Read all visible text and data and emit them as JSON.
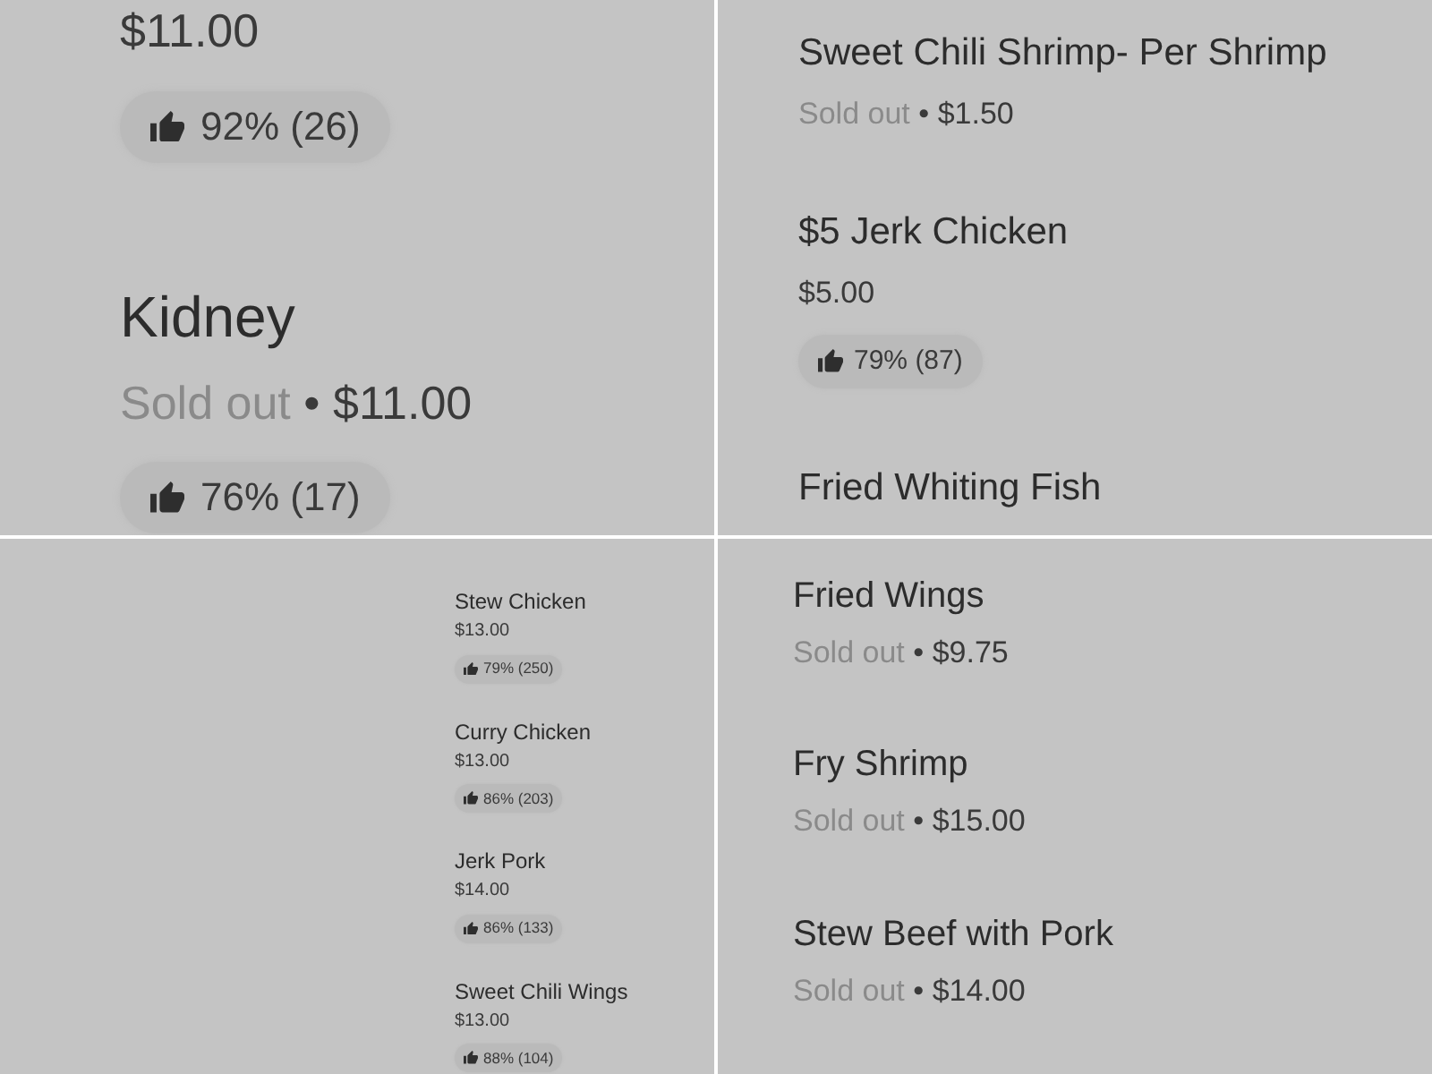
{
  "panels": [
    {
      "items": [
        {
          "price": "$11.00",
          "rating": "92% (26)"
        },
        {
          "title": "Kidney",
          "status": "Sold out",
          "separator": "•",
          "price": "$11.00",
          "rating": "76% (17)"
        }
      ]
    },
    {
      "items": [
        {
          "title": "Sweet Chili Shrimp- Per Shrimp",
          "status": "Sold out",
          "separator": "•",
          "price": "$1.50"
        },
        {
          "title": "$5 Jerk Chicken",
          "price": "$5.00",
          "rating": "79% (87)"
        },
        {
          "title": "Fried Whiting Fish"
        }
      ]
    },
    {
      "items": [
        {
          "title": "Stew Chicken",
          "price": "$13.00",
          "rating": "79% (250)"
        },
        {
          "title": "Curry Chicken",
          "price": "$13.00",
          "rating": "86% (203)"
        },
        {
          "title": "Jerk Pork",
          "price": "$14.00",
          "rating": "86% (133)"
        },
        {
          "title": "Sweet Chili Wings",
          "price": "$13.00",
          "rating": "88% (104)"
        }
      ]
    },
    {
      "items": [
        {
          "title": "Fried Wings",
          "status": "Sold out",
          "separator": "•",
          "price": "$9.75"
        },
        {
          "title": "Fry Shrimp",
          "status": "Sold out",
          "separator": "•",
          "price": "$15.00"
        },
        {
          "title": "Stew Beef with Pork",
          "status": "Sold out",
          "separator": "•",
          "price": "$14.00"
        }
      ]
    }
  ]
}
